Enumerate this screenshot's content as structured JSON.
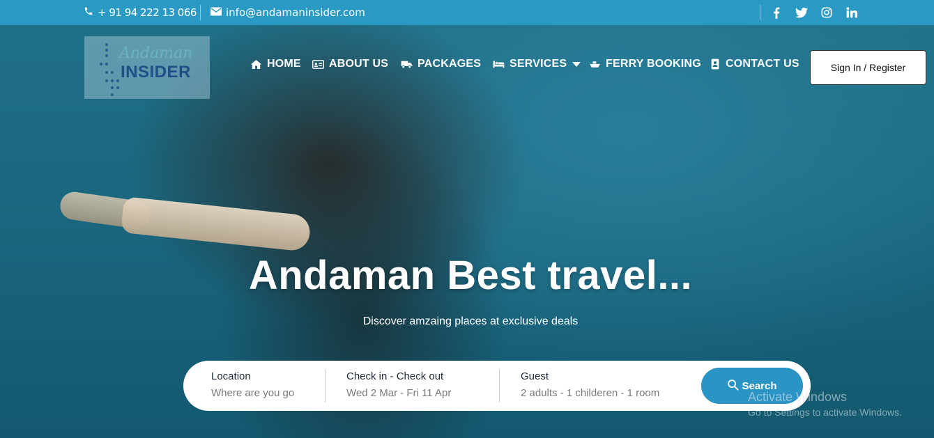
{
  "topbar": {
    "phone": "+ 91 94 222 13 066",
    "email": "info@andamaninsider.com",
    "social": [
      "facebook-icon",
      "twitter-icon",
      "instagram-icon",
      "linkedin-icon"
    ]
  },
  "logo": {
    "script": "Andaman",
    "word": "INSIDER"
  },
  "nav": {
    "home": "HOME",
    "about": "ABOUT US",
    "packages": "PACKAGES",
    "services": "SERVICES",
    "ferry": "FERRY BOOKING",
    "contact": "CONTACT US"
  },
  "auth": {
    "label": "Sign In / Register"
  },
  "hero": {
    "title": "Andaman Best travel...",
    "subtitle": "Discover amzaing places at exclusive deals"
  },
  "search": {
    "location_label": "Location",
    "location_value": "Where are you go",
    "dates_label": "Check in - Check out",
    "dates_value": "Wed 2 Mar - Fri 11 Apr",
    "guest_label": "Guest",
    "guest_value": "2 adults - 1 childeren - 1 room",
    "button": "Search"
  },
  "watermark": {
    "line1": "Activate Windows",
    "line2": "Go to Settings to activate Windows."
  },
  "colors": {
    "topbar": "#2a9ac4",
    "button": "#2a94c4"
  }
}
